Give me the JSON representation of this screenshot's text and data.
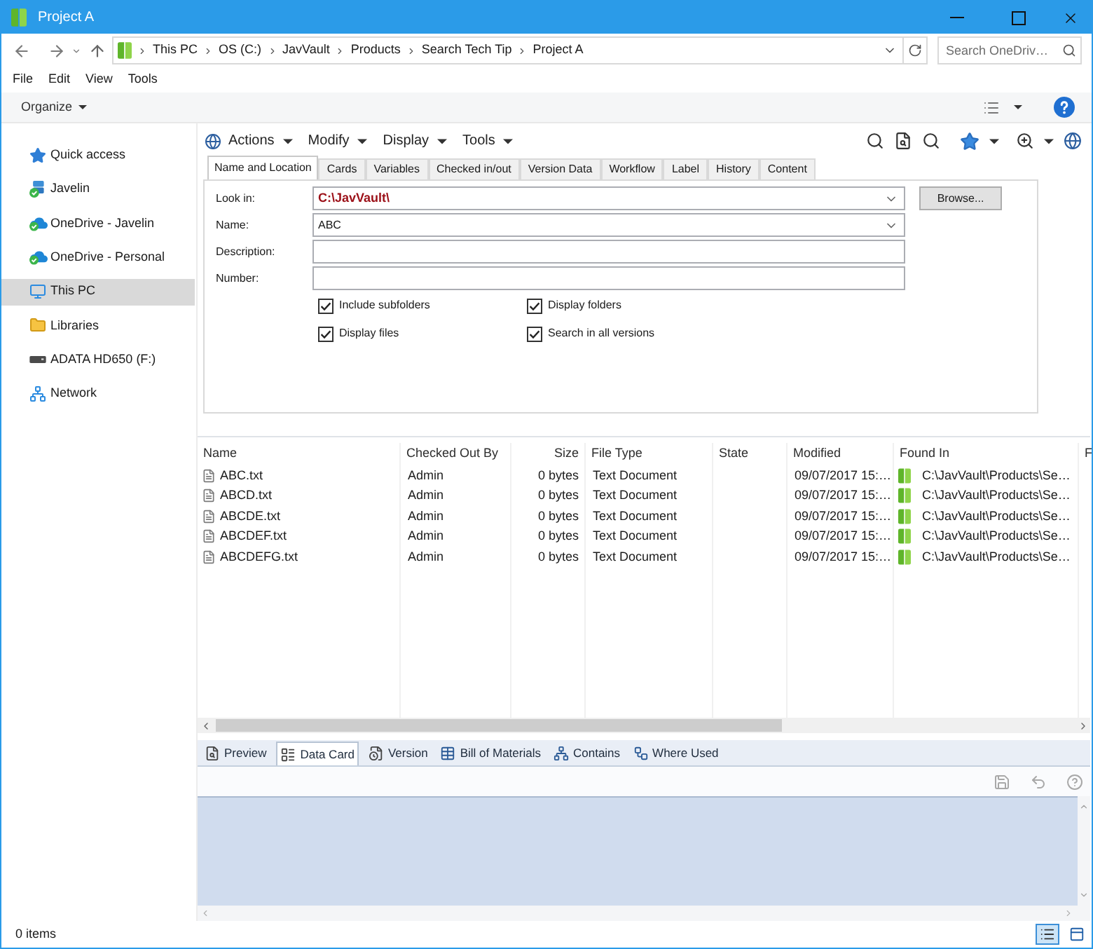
{
  "window": {
    "title": "Project A"
  },
  "address_bar": {
    "segments": [
      "This PC",
      "OS (C:)",
      "JavVault",
      "Products",
      "Search Tech Tip",
      "Project A"
    ]
  },
  "search": {
    "placeholder": "Search OneDriv…"
  },
  "menu_bar": [
    "File",
    "Edit",
    "View",
    "Tools"
  ],
  "command_bar": {
    "organize": "Organize"
  },
  "sidebar": {
    "items": [
      {
        "label": "Quick access",
        "selected": false
      },
      {
        "label": "Javelin",
        "selected": false
      },
      {
        "label": "OneDrive - Javelin",
        "selected": false
      },
      {
        "label": "OneDrive - Personal",
        "selected": false
      },
      {
        "label": "This PC",
        "selected": true
      },
      {
        "label": "Libraries",
        "selected": false
      },
      {
        "label": "ADATA HD650 (F:)",
        "selected": false
      },
      {
        "label": "Network",
        "selected": false
      }
    ]
  },
  "vault_toolbar": {
    "menus": [
      "Actions",
      "Modify",
      "Display",
      "Tools"
    ]
  },
  "search_tabs": [
    {
      "label": "Name and Location",
      "selected": true
    },
    {
      "label": "Cards",
      "selected": false
    },
    {
      "label": "Variables",
      "selected": false
    },
    {
      "label": "Checked in/out",
      "selected": false
    },
    {
      "label": "Version Data",
      "selected": false
    },
    {
      "label": "Workflow",
      "selected": false
    },
    {
      "label": "Label",
      "selected": false
    },
    {
      "label": "History",
      "selected": false
    },
    {
      "label": "Content",
      "selected": false
    }
  ],
  "search_form": {
    "fields": [
      {
        "label": "Look in:",
        "kind": "combo",
        "value": "C:\\JavVault\\",
        "highlighted": true
      },
      {
        "label": "Name:",
        "kind": "combo",
        "value": "ABC",
        "highlighted": false
      },
      {
        "label": "Description:",
        "kind": "text"
      },
      {
        "label": "Number:",
        "kind": "text"
      }
    ],
    "browse_button": "Browse...",
    "options": [
      {
        "label": "Include subfolders",
        "checked": true
      },
      {
        "label": "Display folders",
        "checked": true
      },
      {
        "label": "Display files",
        "checked": true
      },
      {
        "label": "Search in all versions",
        "checked": true
      }
    ]
  },
  "results": {
    "columns": [
      "Name",
      "Checked Out By",
      "Size",
      "File Type",
      "State",
      "Modified",
      "Found In",
      "F"
    ],
    "rows": [
      {
        "name": "ABC.txt",
        "checked_out_by": "Admin",
        "size": "0 bytes",
        "file_type": "Text Document",
        "modified": "09/07/2017 15:…",
        "found_in": "C:\\JavVault\\Products\\Se…"
      },
      {
        "name": "ABCD.txt",
        "checked_out_by": "Admin",
        "size": "0 bytes",
        "file_type": "Text Document",
        "modified": "09/07/2017 15:…",
        "found_in": "C:\\JavVault\\Products\\Se…"
      },
      {
        "name": "ABCDE.txt",
        "checked_out_by": "Admin",
        "size": "0 bytes",
        "file_type": "Text Document",
        "modified": "09/07/2017 15:…",
        "found_in": "C:\\JavVault\\Products\\Se…"
      },
      {
        "name": "ABCDEF.txt",
        "checked_out_by": "Admin",
        "size": "0 bytes",
        "file_type": "Text Document",
        "modified": "09/07/2017 15:…",
        "found_in": "C:\\JavVault\\Products\\Se…"
      },
      {
        "name": "ABCDEFG.txt",
        "checked_out_by": "Admin",
        "size": "0 bytes",
        "file_type": "Text Document",
        "modified": "09/07/2017 15:…",
        "found_in": "C:\\JavVault\\Products\\Se…"
      }
    ]
  },
  "preview_tabs": [
    {
      "label": "Preview",
      "selected": false
    },
    {
      "label": "Data Card",
      "selected": true
    },
    {
      "label": "Version",
      "selected": false
    },
    {
      "label": "Bill of Materials",
      "selected": false
    },
    {
      "label": "Contains",
      "selected": false
    },
    {
      "label": "Where Used",
      "selected": false
    }
  ],
  "status_bar": {
    "text": "0 items",
    "views": [
      {
        "selected": true
      },
      {
        "selected": false
      }
    ]
  }
}
